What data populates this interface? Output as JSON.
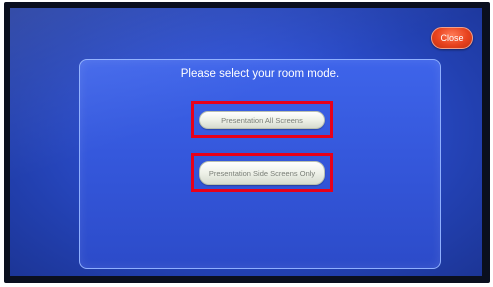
{
  "close_button": {
    "label": "Close"
  },
  "dialog": {
    "title": "Please select your room mode.",
    "modes": [
      {
        "label": "Presentation All Screens"
      },
      {
        "label": "Presentation Side Screens Only"
      }
    ]
  },
  "colors": {
    "screen_background": "#2d4fd0",
    "close_button": "#e8431f",
    "highlight_frame": "#e8001a",
    "mode_button": "#eef1e8"
  }
}
